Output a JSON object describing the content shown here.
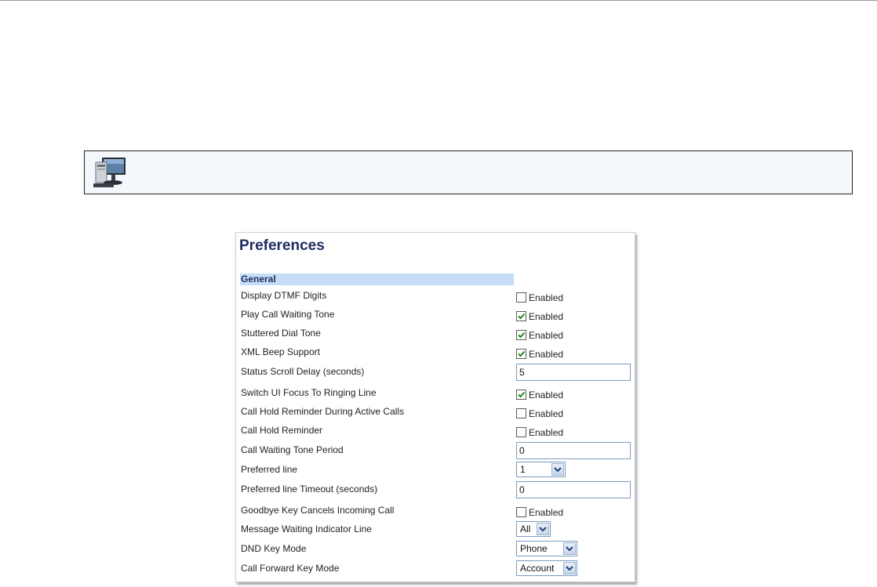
{
  "page": {
    "title": "Preferences"
  },
  "section": {
    "general": "General"
  },
  "rows": [
    {
      "label": "Display DTMF Digits",
      "type": "checkbox",
      "checked": false,
      "text": "Enabled"
    },
    {
      "label": "Play Call Waiting Tone",
      "type": "checkbox",
      "checked": true,
      "text": "Enabled"
    },
    {
      "label": "Stuttered Dial Tone",
      "type": "checkbox",
      "checked": true,
      "text": "Enabled"
    },
    {
      "label": "XML Beep Support",
      "type": "checkbox",
      "checked": true,
      "text": "Enabled"
    },
    {
      "label": "Status Scroll Delay (seconds)",
      "type": "text",
      "value": "5"
    },
    {
      "label": "Switch UI Focus To Ringing Line",
      "type": "checkbox",
      "checked": true,
      "text": "Enabled"
    },
    {
      "label": "Call Hold Reminder During Active Calls",
      "type": "checkbox",
      "checked": false,
      "text": "Enabled"
    },
    {
      "label": "Call Hold Reminder",
      "type": "checkbox",
      "checked": false,
      "text": "Enabled"
    },
    {
      "label": "Call Waiting Tone Period",
      "type": "text",
      "value": "0"
    },
    {
      "label": "Preferred line",
      "type": "select",
      "value": "1"
    },
    {
      "label": "Preferred line Timeout (seconds)",
      "type": "text",
      "value": "0"
    },
    {
      "label": "Goodbye Key Cancels Incoming Call",
      "type": "checkbox",
      "checked": false,
      "text": "Enabled"
    },
    {
      "label": "Message Waiting Indicator Line",
      "type": "select",
      "value": "All"
    },
    {
      "label": "DND Key Mode",
      "type": "select",
      "value": "Phone"
    },
    {
      "label": "Call Forward Key Mode",
      "type": "select",
      "value": "Account"
    }
  ],
  "icons": {
    "note": "computer-monitor-icon",
    "dropdown": "chevron-down-icon"
  },
  "colors": {
    "title": "#1f2b5f",
    "section": "#c5ddf6",
    "check": "#1e8a1e",
    "field_border": "#7a9cbf"
  }
}
